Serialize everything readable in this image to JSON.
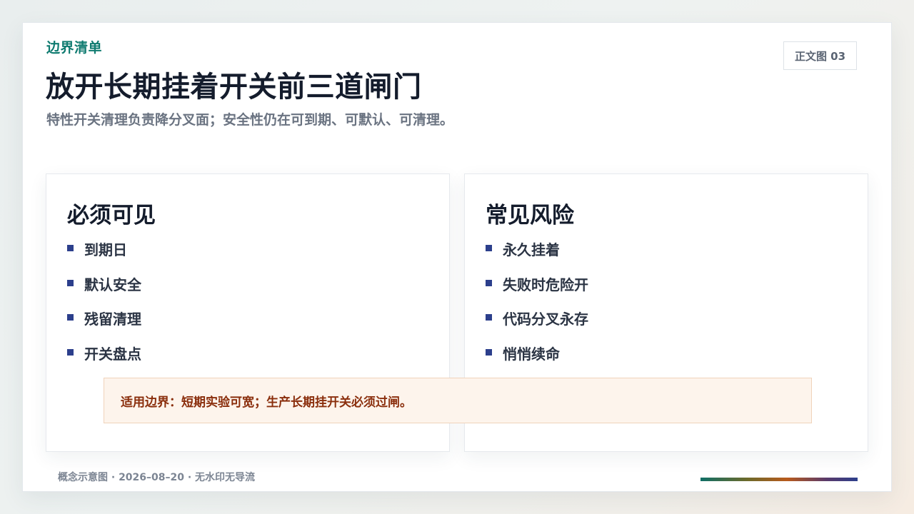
{
  "header": {
    "kicker": "边界清单",
    "title": "放开长期挂着开关前三道闸门",
    "subtitle": "特性开关清理负责降分叉面；安全性仍在可到期、可默认、可清理。",
    "tag": "正文图 03"
  },
  "cards": [
    {
      "title": "必须可见",
      "items": [
        "到期日",
        "默认安全",
        "残留清理",
        "开关盘点"
      ]
    },
    {
      "title": "常见风险",
      "items": [
        "永久挂着",
        "失败时危险开",
        "代码分叉永存",
        "悄悄续命"
      ]
    }
  ],
  "note": "适用边界：短期实验可宽；生产长期挂开关必须过闸。",
  "footer": "概念示意图 · 2026–08–20 · 无水印无导流",
  "colors": {
    "accent_teal": "#0f7b70",
    "bullet_blue": "#2c3f8c",
    "note_text": "#8a2e0c",
    "note_bg": "#fdf4ec"
  }
}
